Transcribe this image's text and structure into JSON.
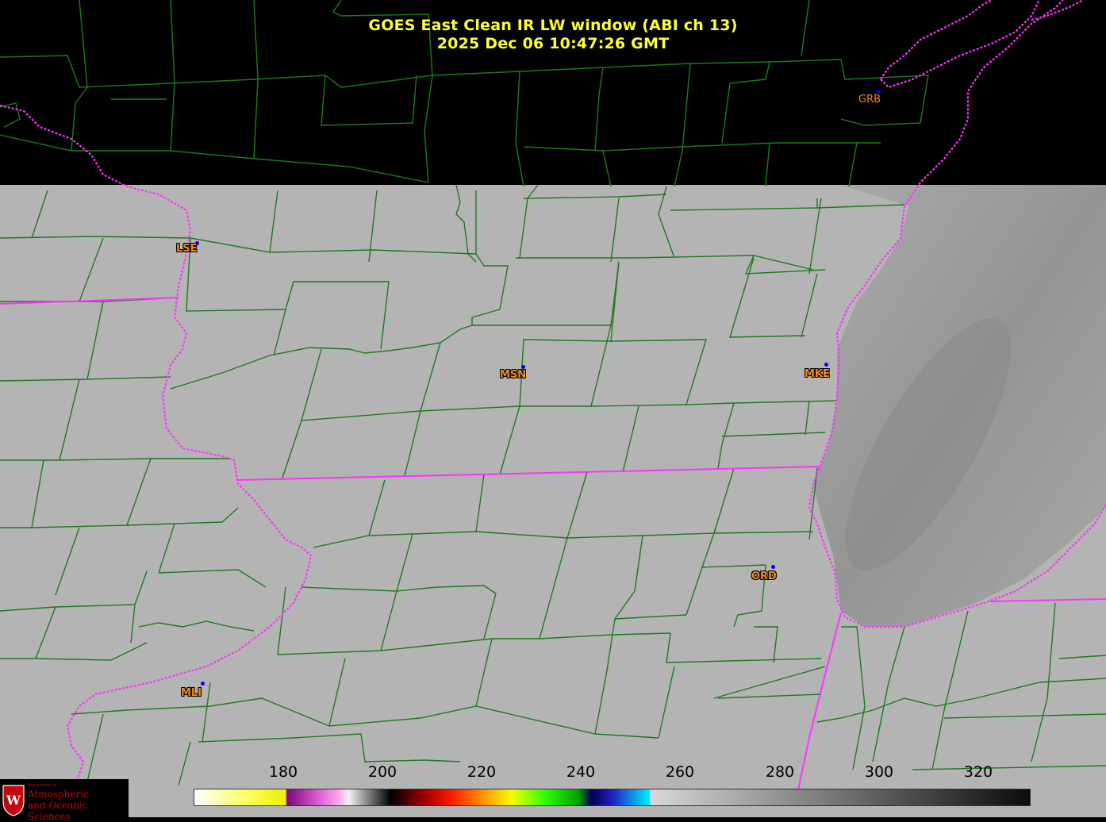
{
  "title": {
    "line1": "GOES East Clean IR LW window (ABI ch 13)",
    "line2": "2025 Dec 06  10:47:26 GMT"
  },
  "stations": [
    {
      "id": "GRB",
      "label": "GRB"
    },
    {
      "id": "LSE",
      "label": "LSE"
    },
    {
      "id": "MSN",
      "label": "MSN"
    },
    {
      "id": "MKE",
      "label": "MKE"
    },
    {
      "id": "ORD",
      "label": "ORD"
    },
    {
      "id": "MLI",
      "label": "MLI"
    }
  ],
  "colorbar": {
    "ticks": [
      "180",
      "200",
      "220",
      "240",
      "260",
      "280",
      "300",
      "320"
    ]
  },
  "logo": {
    "line1": "Department of",
    "line2": "Atmospheric",
    "line3": "and Oceanic Sciences"
  },
  "colors": {
    "title": "#ffff33",
    "county_lines": "#1f7a1f",
    "state_lines": "#ff33ff",
    "station_label": "#f08a24",
    "station_dot": "#0000ff",
    "cloud_gray": "#b4b4b4"
  }
}
